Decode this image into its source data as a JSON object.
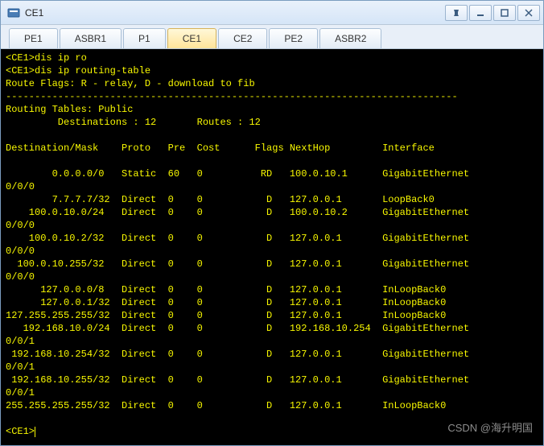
{
  "window": {
    "title": "CE1"
  },
  "tabs": [
    {
      "label": "PE1",
      "active": false
    },
    {
      "label": "ASBR1",
      "active": false
    },
    {
      "label": "P1",
      "active": false
    },
    {
      "label": "CE1",
      "active": true
    },
    {
      "label": "CE2",
      "active": false
    },
    {
      "label": "PE2",
      "active": false
    },
    {
      "label": "ASBR2",
      "active": false
    }
  ],
  "terminal": {
    "prompt": "<CE1>",
    "cmd1": "<CE1>dis ip ro",
    "cmd2": "<CE1>dis ip routing-table",
    "flags": "Route Flags: R - relay, D - download to fib",
    "dashes": "------------------------------------------------------------------------------",
    "tables": "Routing Tables: Public",
    "summary": "         Destinations : 12       Routes : 12",
    "blank": "",
    "header": "Destination/Mask    Proto   Pre  Cost      Flags NextHop         Interface",
    "routes": [
      {
        "line": "        0.0.0.0/0   Static  60   0          RD   100.0.10.1      GigabitEthernet",
        "cont": "0/0/0"
      },
      {
        "line": "        7.7.7.7/32  Direct  0    0           D   127.0.0.1       LoopBack0",
        "cont": null
      },
      {
        "line": "    100.0.10.0/24   Direct  0    0           D   100.0.10.2      GigabitEthernet",
        "cont": "0/0/0"
      },
      {
        "line": "    100.0.10.2/32   Direct  0    0           D   127.0.0.1       GigabitEthernet",
        "cont": "0/0/0"
      },
      {
        "line": "  100.0.10.255/32   Direct  0    0           D   127.0.0.1       GigabitEthernet",
        "cont": "0/0/0"
      },
      {
        "line": "      127.0.0.0/8   Direct  0    0           D   127.0.0.1       InLoopBack0",
        "cont": null
      },
      {
        "line": "      127.0.0.1/32  Direct  0    0           D   127.0.0.1       InLoopBack0",
        "cont": null
      },
      {
        "line": "127.255.255.255/32  Direct  0    0           D   127.0.0.1       InLoopBack0",
        "cont": null
      },
      {
        "line": "   192.168.10.0/24  Direct  0    0           D   192.168.10.254  GigabitEthernet",
        "cont": "0/0/1"
      },
      {
        "line": " 192.168.10.254/32  Direct  0    0           D   127.0.0.1       GigabitEthernet",
        "cont": "0/0/1"
      },
      {
        "line": " 192.168.10.255/32  Direct  0    0           D   127.0.0.1       GigabitEthernet",
        "cont": "0/0/1"
      },
      {
        "line": "255.255.255.255/32  Direct  0    0           D   127.0.0.1       InLoopBack0",
        "cont": null
      }
    ]
  },
  "watermark": "CSDN @海升明国"
}
